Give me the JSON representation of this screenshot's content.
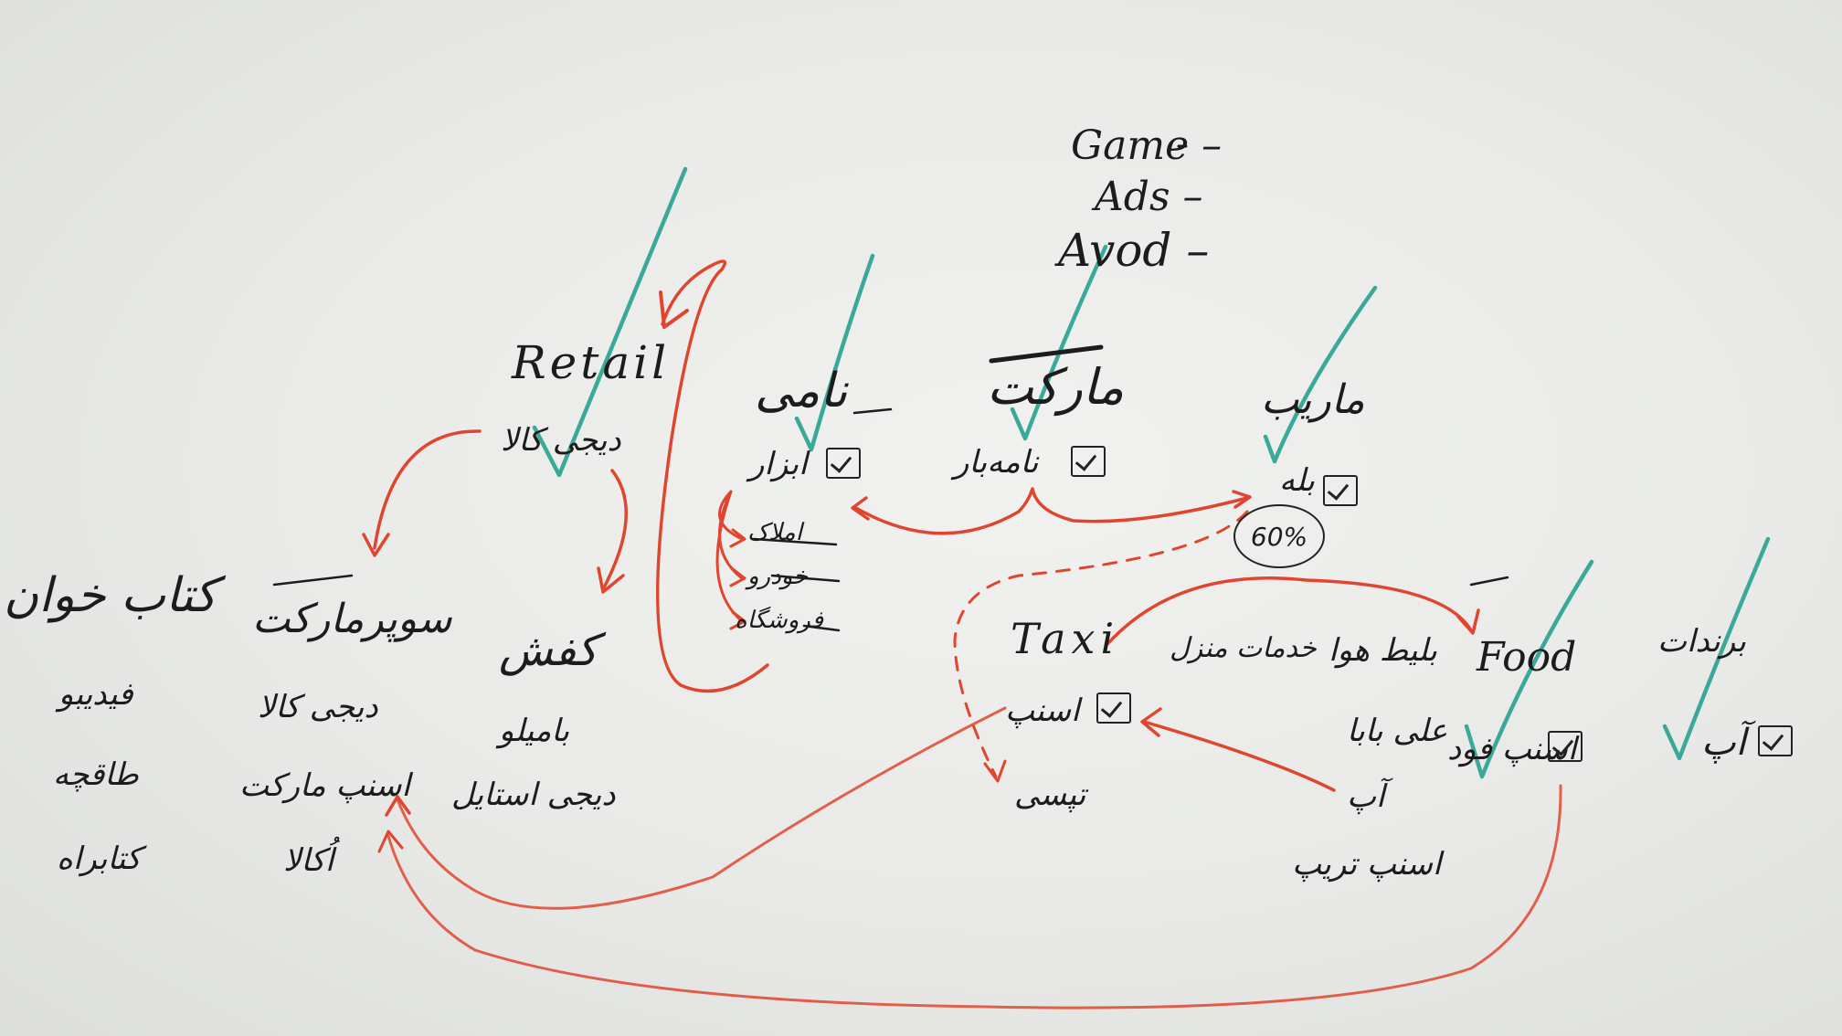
{
  "board": {
    "top_center": {
      "game": "Game",
      "ads": "Ads",
      "avod": "Avod"
    },
    "headers": {
      "retail": "Retail",
      "nami": "نامی",
      "market": "مارکت",
      "marib": "ماریب",
      "food": "Food",
      "taxi": "Taxi",
      "ketab": "کتاب خوان",
      "sooper": "سوپرمارکت",
      "kafsh": "کفش",
      "khadamat": "خدمات منزل",
      "belit": "بلیط هوا",
      "barandat": "برندات"
    },
    "retail_col": {
      "digikala": "دیجی کالا"
    },
    "nami_col": {
      "abzar": "ابزار",
      "amlak": "املاک",
      "khodro": "خودرو",
      "forooshgah": "فروشگاه"
    },
    "market_col": {
      "kamebar": "نامه‌بار"
    },
    "marib_col": {
      "baleh": "بله",
      "percent": "60%"
    },
    "ketab_col": {
      "fidibo": "فیدیبو",
      "taaghche": "طاقچه",
      "ketabrah": "کتابراه"
    },
    "sooper_col": {
      "digikala": "دیجی کالا",
      "snappmarket": "اسنپ مارکت",
      "okala": "اُکالا"
    },
    "kafsh_col": {
      "bamilo": "بامیلو",
      "digistyle": "دیجی استایل"
    },
    "taxi_col": {
      "snapp": "اسنپ",
      "tapsi": "تپسی"
    },
    "belit_col": {
      "alibaba": "علی بابا",
      "ap": "آپ",
      "snapptrip": "اسنپ تریپ"
    },
    "food_col": {
      "snappfood": "اسنپ فود"
    },
    "barandat_col": {
      "ap": "آپ"
    },
    "colors": {
      "board": "#ecedeb",
      "marker_black": "#1c1c1c",
      "marker_red": "#e0462f",
      "marker_teal": "#3aa99a"
    }
  }
}
